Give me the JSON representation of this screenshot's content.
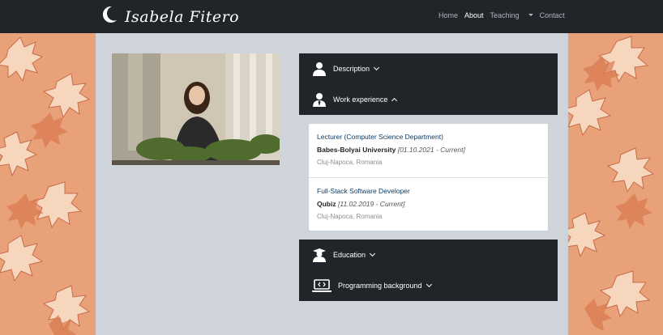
{
  "brand": {
    "name": "Isabela Fitero",
    "logo_icon": "crescent-moon-icon"
  },
  "nav": {
    "items": [
      {
        "label": "Home",
        "active": false
      },
      {
        "label": "About",
        "active": true
      },
      {
        "label": "Teaching",
        "active": false,
        "dropdown": true
      },
      {
        "label": "Contact",
        "active": false
      }
    ]
  },
  "sections": {
    "description": {
      "label": "Description",
      "icon": "person-icon",
      "expanded": false
    },
    "work": {
      "label": "Work experience",
      "icon": "person-tie-icon",
      "expanded": true,
      "jobs": [
        {
          "title": "Lecturer (Computer Science Department)",
          "organization": "Babes-Bolyai University",
          "dates": "[01.10.2021 - Current]",
          "location": "Cluj-Napoca, Romania"
        },
        {
          "title": "Full-Stack Software Developer",
          "organization": "Qubiz",
          "dates": "[11.02.2019 - Current]",
          "location": "Cluj-Napoca, Romania"
        }
      ]
    },
    "education": {
      "label": "Education",
      "icon": "graduate-icon",
      "expanded": false
    },
    "programming": {
      "label": "Programming background",
      "icon": "laptop-code-icon",
      "expanded": false
    }
  },
  "colors": {
    "navbar": "#212529",
    "page": "#ced4da",
    "link": "#0d3b66",
    "leaf_bg": "#e8a178"
  }
}
